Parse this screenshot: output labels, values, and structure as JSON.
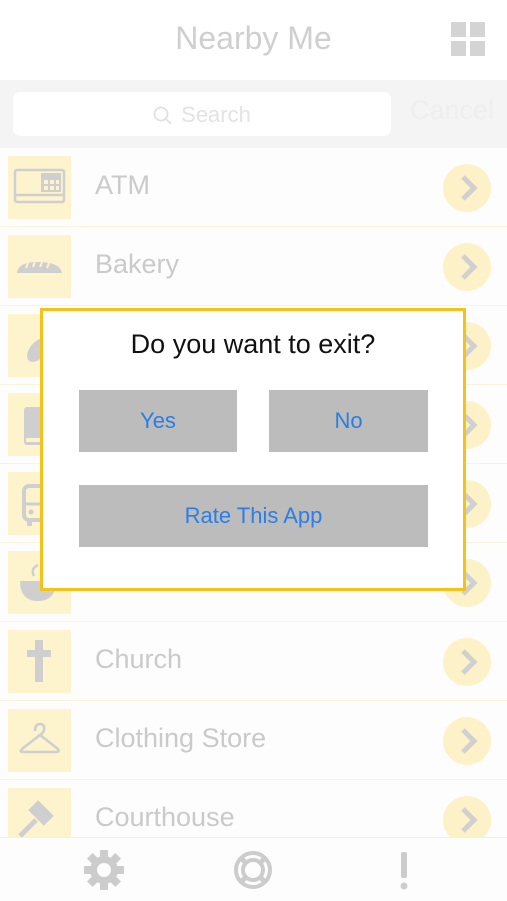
{
  "header": {
    "title": "Nearby Me",
    "menu_icon": "grid-icon"
  },
  "search": {
    "placeholder": "Search",
    "cancel_label": "Cancel",
    "icon": "search-icon"
  },
  "list": {
    "items": [
      {
        "label": "ATM",
        "icon": "atm-icon"
      },
      {
        "label": "Bakery",
        "icon": "bread-icon"
      },
      {
        "label": "",
        "icon": "coins-icon"
      },
      {
        "label": "",
        "icon": "book-icon"
      },
      {
        "label": "",
        "icon": "bus-icon"
      },
      {
        "label": "",
        "icon": "coffee-cup-icon"
      },
      {
        "label": "Church",
        "icon": "cross-icon"
      },
      {
        "label": "Clothing Store",
        "icon": "hanger-icon"
      },
      {
        "label": "Courthouse",
        "icon": "gavel-icon"
      }
    ]
  },
  "tabbar": {
    "items": [
      "gear-icon",
      "lifebuoy-icon",
      "exclamation-icon"
    ]
  },
  "dialog": {
    "title": "Do you want to exit?",
    "yes_label": "Yes",
    "no_label": "No",
    "rate_label": "Rate This App"
  },
  "colors": {
    "accent": "#f3c21b",
    "button_text": "#2a7ee6",
    "button_bg": "#bcbcbc",
    "row_icon_bg": "#fdf3cc"
  }
}
